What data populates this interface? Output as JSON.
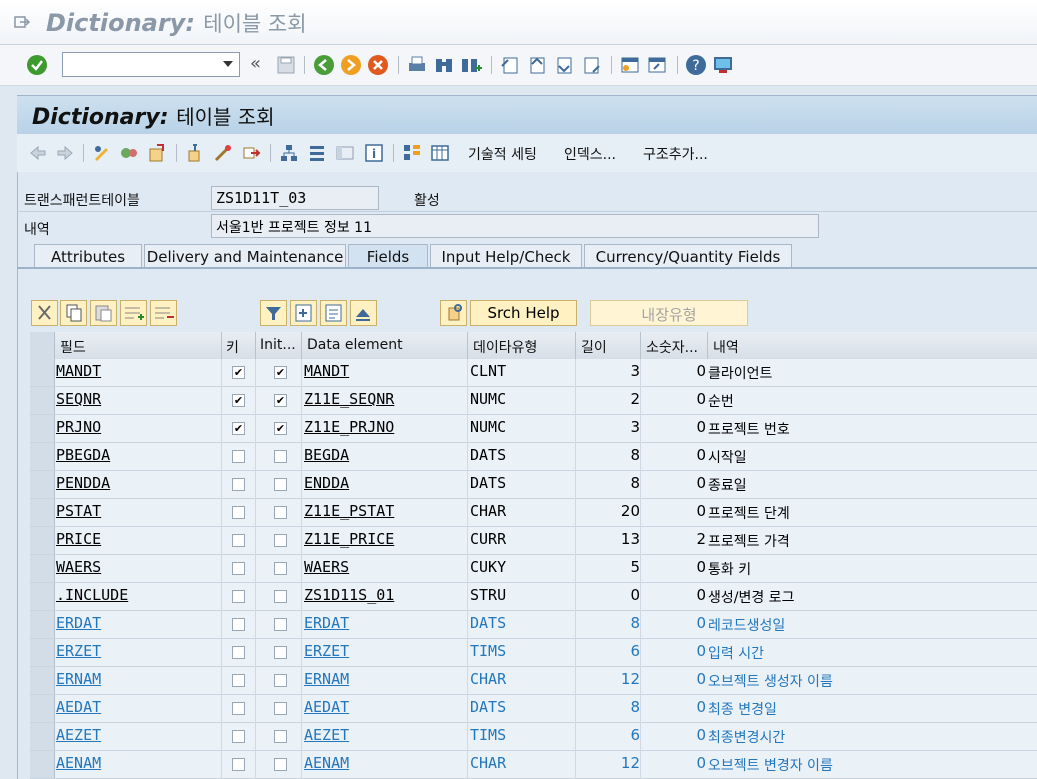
{
  "window": {
    "title_bold": "Dictionary:",
    "title_ko": "테이블 조회"
  },
  "panel": {
    "title_bold": "Dictionary:",
    "title_ko": "테이블 조회"
  },
  "appbar": {
    "tech_settings": "기술적 세팅",
    "indexes": "인덱스...",
    "append_structure": "구조추가..."
  },
  "header_fields": {
    "transparent_table_label": "트랜스패런트테이블",
    "table_name": "ZS1D11T_03",
    "status": "활성",
    "desc_label": "내역",
    "desc_value": "서울1반 프로젝트 정보 11"
  },
  "tabs": [
    "Attributes",
    "Delivery and Maintenance",
    "Fields",
    "Input Help/Check",
    "Currency/Quantity Fields"
  ],
  "active_tab": "Fields",
  "table_controls": {
    "srch_help": "Srch Help",
    "builtin_type": "내장유형"
  },
  "columns": [
    "필드",
    "키",
    "Init...",
    "Data element",
    "데이타유형",
    "길이",
    "소숫자...",
    "내역"
  ],
  "rows": [
    {
      "field": "MANDT",
      "key": true,
      "init": true,
      "de": "MANDT",
      "type": "CLNT",
      "len": "3",
      "dec": "0",
      "desc": "클라이언트",
      "included": false
    },
    {
      "field": "SEQNR",
      "key": true,
      "init": true,
      "de": "Z11E_SEQNR",
      "type": "NUMC",
      "len": "2",
      "dec": "0",
      "desc": "순번",
      "included": false
    },
    {
      "field": "PRJNO",
      "key": true,
      "init": true,
      "de": "Z11E_PRJNO",
      "type": "NUMC",
      "len": "3",
      "dec": "0",
      "desc": "프로젝트 번호",
      "included": false
    },
    {
      "field": "PBEGDA",
      "key": false,
      "init": false,
      "de": "BEGDA",
      "type": "DATS",
      "len": "8",
      "dec": "0",
      "desc": "시작일",
      "included": false
    },
    {
      "field": "PENDDA",
      "key": false,
      "init": false,
      "de": "ENDDA",
      "type": "DATS",
      "len": "8",
      "dec": "0",
      "desc": "종료일",
      "included": false
    },
    {
      "field": "PSTAT",
      "key": false,
      "init": false,
      "de": "Z11E_PSTAT",
      "type": "CHAR",
      "len": "20",
      "dec": "0",
      "desc": "프로젝트 단계",
      "included": false
    },
    {
      "field": "PRICE",
      "key": false,
      "init": false,
      "de": "Z11E_PRICE",
      "type": "CURR",
      "len": "13",
      "dec": "2",
      "desc": "프로젝트 가격",
      "included": false
    },
    {
      "field": "WAERS",
      "key": false,
      "init": false,
      "de": "WAERS",
      "type": "CUKY",
      "len": "5",
      "dec": "0",
      "desc": "통화 키",
      "included": false
    },
    {
      "field": ".INCLUDE",
      "key": false,
      "init": false,
      "de": "ZS1D11S_01",
      "type": "STRU",
      "len": "0",
      "dec": "0",
      "desc": "생성/변경 로그",
      "included": false
    },
    {
      "field": "ERDAT",
      "key": false,
      "init": false,
      "de": "ERDAT",
      "type": "DATS",
      "len": "8",
      "dec": "0",
      "desc": "레코드생성일",
      "included": true
    },
    {
      "field": "ERZET",
      "key": false,
      "init": false,
      "de": "ERZET",
      "type": "TIMS",
      "len": "6",
      "dec": "0",
      "desc": "입력 시간",
      "included": true
    },
    {
      "field": "ERNAM",
      "key": false,
      "init": false,
      "de": "ERNAM",
      "type": "CHAR",
      "len": "12",
      "dec": "0",
      "desc": "오브젝트 생성자 이름",
      "included": true
    },
    {
      "field": "AEDAT",
      "key": false,
      "init": false,
      "de": "AEDAT",
      "type": "DATS",
      "len": "8",
      "dec": "0",
      "desc": "최종 변경일",
      "included": true
    },
    {
      "field": "AEZET",
      "key": false,
      "init": false,
      "de": "AEZET",
      "type": "TIMS",
      "len": "6",
      "dec": "0",
      "desc": "최종변경시간",
      "included": true
    },
    {
      "field": "AENAM",
      "key": false,
      "init": false,
      "de": "AENAM",
      "type": "CHAR",
      "len": "12",
      "dec": "0",
      "desc": "오브젝트 변경자 이름",
      "included": true
    }
  ],
  "colors": {
    "included_text": "#2377bd",
    "row_bg": "#eaf1f7",
    "header_bg": "#b9d2e8"
  }
}
